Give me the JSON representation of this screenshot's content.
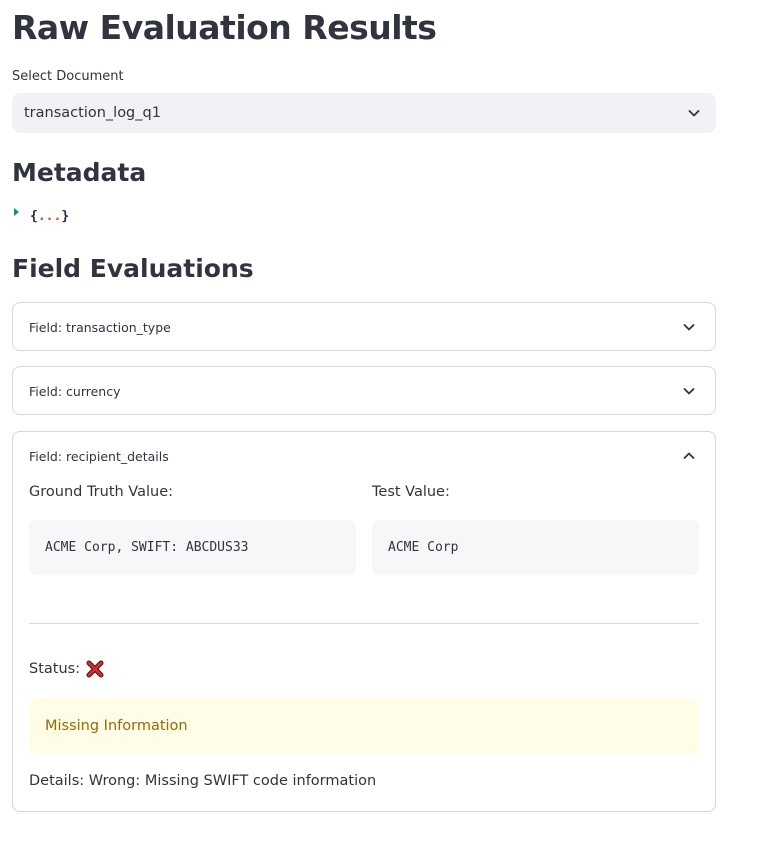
{
  "page": {
    "title": "Raw Evaluation Results"
  },
  "select_document": {
    "label": "Select Document",
    "value": "transaction_log_q1",
    "icon": "chevron-down-icon"
  },
  "metadata": {
    "heading": "Metadata",
    "json_open": "{",
    "json_dots": "...",
    "json_close": "}"
  },
  "field_evaluations": {
    "heading": "Field Evaluations",
    "expanders": [
      {
        "title": "Field: transaction_type",
        "expanded": false
      },
      {
        "title": "Field: currency",
        "expanded": false
      },
      {
        "title": "Field: recipient_details",
        "expanded": true,
        "ground_truth_label": "Ground Truth Value:",
        "ground_truth_value": "ACME Corp, SWIFT: ABCDUS33",
        "test_label": "Test Value:",
        "test_value": "ACME Corp",
        "status_label": "Status:",
        "status_icon": "cross-mark-icon",
        "warning_text": "Missing Information",
        "details_text": "Details: Wrong: Missing SWIFT code information"
      }
    ]
  },
  "colors": {
    "text": "#31333f",
    "select_bg": "#f0f2f6",
    "warning_bg": "#fffce7",
    "warning_text": "#926c05",
    "json_toggle": "#0a9396",
    "json_dots": "#d9480f",
    "cross_red": "#d0312d"
  }
}
